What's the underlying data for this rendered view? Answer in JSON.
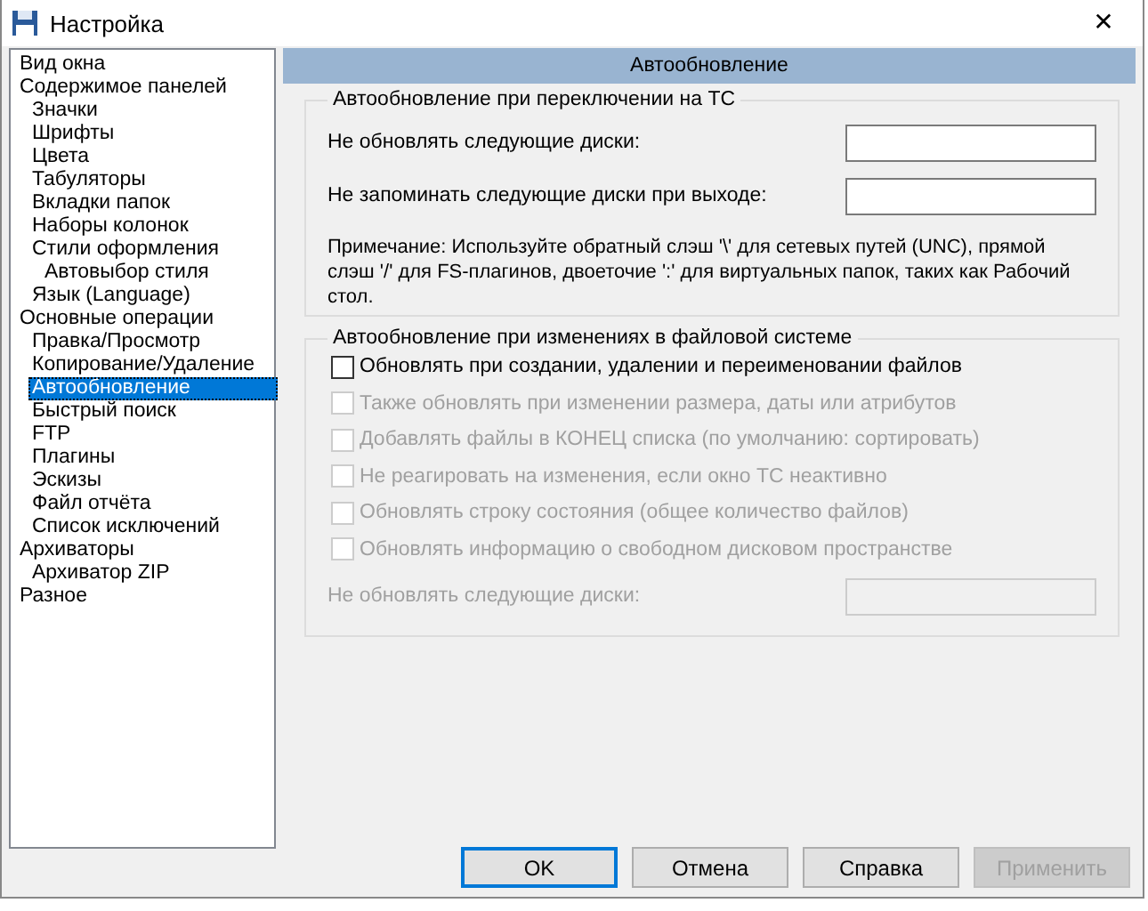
{
  "window": {
    "title": "Настройка",
    "close": "✕"
  },
  "tree": [
    {
      "label": "Вид окна",
      "selected": false
    },
    {
      "label": "Содержимое панелей",
      "selected": false,
      "children": [
        {
          "label": "Значки",
          "selected": false
        },
        {
          "label": "Шрифты",
          "selected": false
        },
        {
          "label": "Цвета",
          "selected": false
        },
        {
          "label": "Табуляторы",
          "selected": false
        },
        {
          "label": "Вкладки папок",
          "selected": false
        },
        {
          "label": "Наборы колонок",
          "selected": false
        },
        {
          "label": "Стили оформления",
          "selected": false,
          "children": [
            {
              "label": "Автовыбор стиля",
              "selected": false
            }
          ]
        },
        {
          "label": "Язык (Language)",
          "selected": false
        }
      ]
    },
    {
      "label": "Основные операции",
      "selected": false,
      "children": [
        {
          "label": "Правка/Просмотр",
          "selected": false
        },
        {
          "label": "Копирование/Удаление",
          "selected": false
        },
        {
          "label": "Автообновление",
          "selected": true
        },
        {
          "label": "Быстрый поиск",
          "selected": false
        },
        {
          "label": "FTP",
          "selected": false
        },
        {
          "label": "Плагины",
          "selected": false
        },
        {
          "label": "Эскизы",
          "selected": false
        },
        {
          "label": "Файл отчёта",
          "selected": false
        },
        {
          "label": "Список исключений",
          "selected": false
        }
      ]
    },
    {
      "label": "Архиваторы",
      "selected": false,
      "children": [
        {
          "label": "Архиватор ZIP",
          "selected": false
        }
      ]
    },
    {
      "label": "Разное",
      "selected": false
    }
  ],
  "page_title": "Автообновление",
  "group_1": {
    "title": "Автообновление при переключении на ТС",
    "fields": [
      {
        "label": "Не обновлять следующие диски:",
        "disabled": false
      },
      {
        "label": "Не запоминать следующие диски при выходе:",
        "disabled": false
      }
    ],
    "note": "Примечание: Используйте обратный слэш '\\' для сетевых путей (UNC), прямой слэш '/' для FS-плагинов, двоеточие ':' для виртуальных папок, таких как Рабочий стол."
  },
  "group_2": {
    "title": "Автообновление при изменениях в файловой системе",
    "checkboxes": [
      {
        "label": "Обновлять при создании, удалении и переименовании файлов",
        "checked": false,
        "disabled": false
      },
      {
        "label": "Также обновлять при изменении размера, даты или атрибутов",
        "checked": false,
        "disabled": true
      },
      {
        "label": "Добавлять файлы в КОНЕЦ списка (по умолчанию: сортировать)",
        "checked": false,
        "disabled": true
      },
      {
        "label": "Не реагировать на изменения, если окно ТС неактивно",
        "checked": false,
        "disabled": true
      },
      {
        "label": "Обновлять строку состояния (общее количество файлов)",
        "checked": false,
        "disabled": true
      },
      {
        "label": "Обновлять информацию о свободном дисковом пространстве",
        "checked": false,
        "disabled": true
      }
    ],
    "field": {
      "label": "Не обновлять следующие диски:",
      "disabled": true
    }
  },
  "buttons": [
    {
      "label": "OK",
      "default": true,
      "disabled": false
    },
    {
      "label": "Отмена",
      "default": false,
      "disabled": false
    },
    {
      "label": "Справка",
      "default": false,
      "disabled": false
    },
    {
      "label": "Применить",
      "default": false,
      "disabled": true
    }
  ]
}
